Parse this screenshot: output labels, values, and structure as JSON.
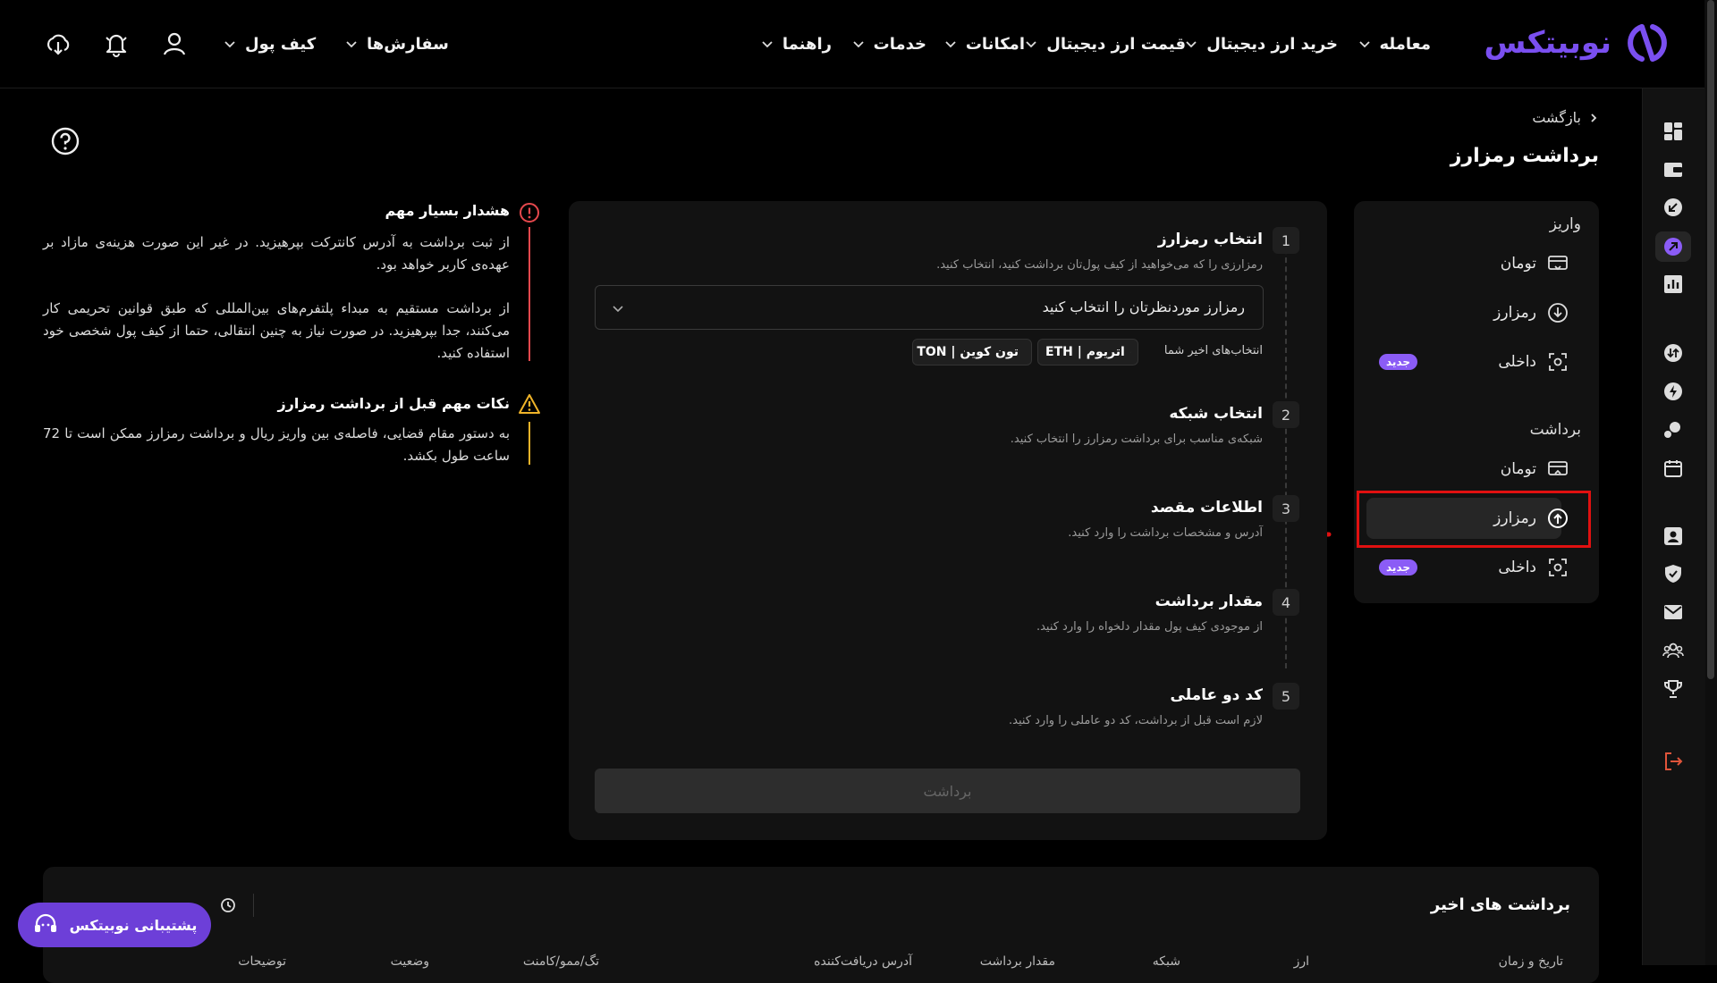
{
  "brand": {
    "name": "نوبیتکس",
    "color": "#7a4ff0"
  },
  "nav": {
    "items": [
      {
        "label": "معامله"
      },
      {
        "label": "خرید ارز دیجیتال"
      },
      {
        "label": "قیمت ارز دیجیتال"
      },
      {
        "label": "امکانات"
      },
      {
        "label": "خدمات"
      },
      {
        "label": "راهنما"
      }
    ],
    "orders": "سفارش‌ها",
    "wallet": "کیف پول"
  },
  "breadcrumb": {
    "back": "بازگشت"
  },
  "page_title": "برداشت رمزارز",
  "submenu": {
    "deposit_header": "واریز",
    "deposit_items": [
      {
        "label": "تومان",
        "icon": "bank-card-icon"
      },
      {
        "label": "رمزارز",
        "icon": "coin-down-icon"
      },
      {
        "label": "داخلی",
        "icon": "scan-icon",
        "badge": "جدید"
      }
    ],
    "withdraw_header": "برداشت",
    "withdraw_items": [
      {
        "label": "تومان",
        "icon": "bank-card-icon"
      },
      {
        "label": "رمزارز",
        "icon": "coin-up-icon"
      },
      {
        "label": "داخلی",
        "icon": "scan-icon",
        "badge": "جدید"
      }
    ]
  },
  "steps": [
    {
      "num": "1",
      "title": "انتخاب رمزارز",
      "desc": "رمزارزی را که می‌خواهید از کیف پول‌تان برداشت کنید، انتخاب کنید."
    },
    {
      "num": "2",
      "title": "انتخاب شبکه",
      "desc": "شبکه‌ی مناسب برای برداشت رمزارز را انتخاب کنید."
    },
    {
      "num": "3",
      "title": "اطلاعات مقصد",
      "desc": "آدرس و مشخصات برداشت را وارد کنید."
    },
    {
      "num": "4",
      "title": "مقدار برداشت",
      "desc": "از موجودی کیف پول مقدار دلخواه را وارد کنید."
    },
    {
      "num": "5",
      "title": "کد دو عاملی",
      "desc": "لازم است قبل از برداشت، کد دو عاملی را وارد کنید."
    }
  ],
  "crypto_select": {
    "placeholder": "رمزارز موردنظرتان را انتخاب کنید"
  },
  "recent_choices": {
    "label": "انتخاب‌های اخیر شما",
    "chips": [
      {
        "label": "اتریوم | ETH",
        "icon": "ethereum-icon"
      },
      {
        "label": "تون کوین | TON",
        "icon": "ton-icon"
      }
    ]
  },
  "withdraw_button": "برداشت",
  "warnings": {
    "important_title": "هشدار بسیار مهم",
    "important_p1": "از ثبت برداشت به آدرس کانترکت بپرهیزید. در غیر این صورت هزینه‌ی مازاد بر عهده‌ی کاربر خواهد بود.",
    "important_p2": "از برداشت مستقیم به مبداء پلتفرم‌های بین‌المللی که طبق قوانین تحریمی کار می‌کنند، جدا بپرهیزید. در صورت نیاز به چنین انتقالی، حتما از کیف پول شخصی خود استفاده کنید.",
    "notes_title": "نکات مهم قبل از برداشت رمزارز",
    "notes_body": "به دستور مقام قضایی، فاصله‌ی بین واریز ریال و برداشت رمزارز ممکن است تا 72 ساعت طول بکشد."
  },
  "recent_withdrawals": {
    "title": "برداشت های اخیر",
    "columns": [
      "تاریخ و زمان",
      "ارز",
      "شبکه",
      "مقدار برداشت",
      "آدرس دریافت‌کننده",
      "تگ/ممو/کامنت",
      "وضعیت",
      "توضیحات"
    ]
  },
  "support": {
    "label": "پشتیبانی نوبیتکس"
  },
  "colors": {
    "accent": "#7a4ff0",
    "danger": "#e01010",
    "badge": "#8b5cf6",
    "warning": "#f0b429"
  }
}
